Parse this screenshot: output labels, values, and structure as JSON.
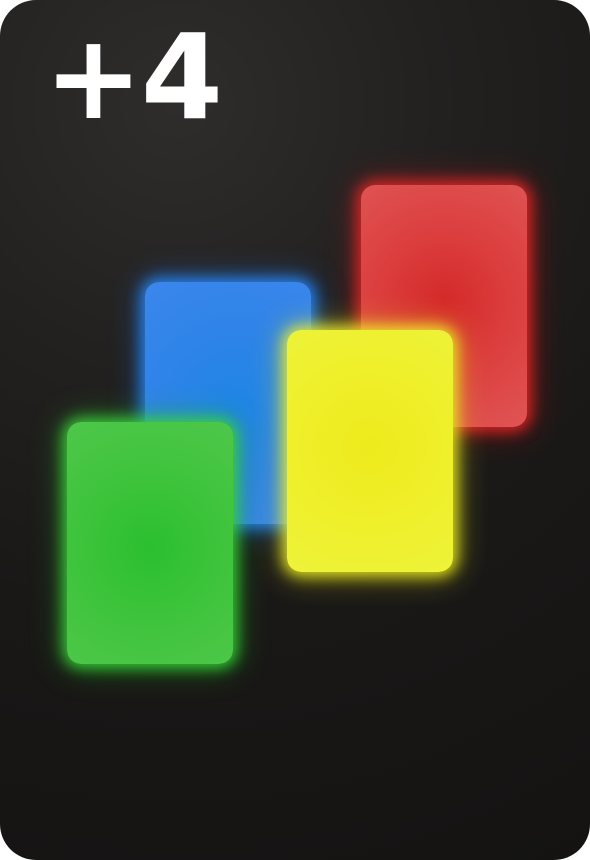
{
  "card": {
    "label": "+4",
    "background_color": "#1c1a19",
    "label_color": "#ffffff"
  },
  "stack": [
    {
      "color_name": "red",
      "color": "#dc3e3e"
    },
    {
      "color_name": "blue",
      "color": "#2d84e8"
    },
    {
      "color_name": "yellow",
      "color": "#efef2a"
    },
    {
      "color_name": "green",
      "color": "#3fc43d"
    }
  ]
}
